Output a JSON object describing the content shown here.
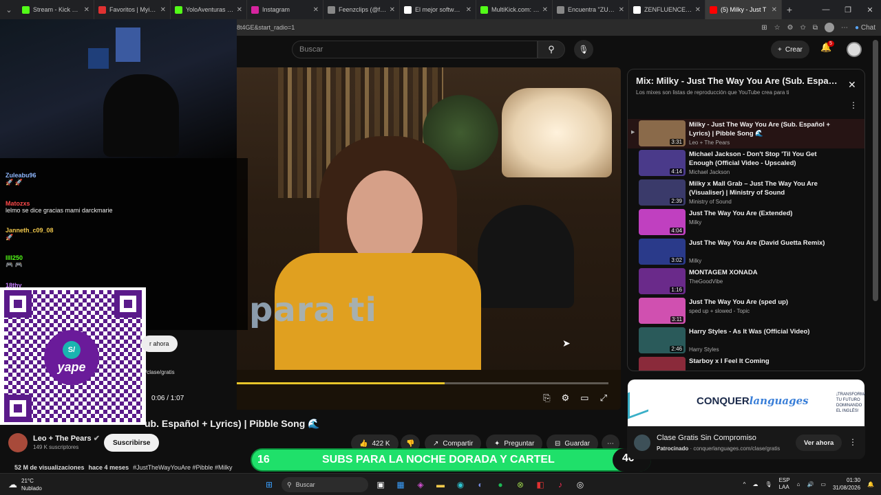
{
  "tabs": [
    {
      "title": "Stream - Kick Dashbo",
      "color": "#53fc18"
    },
    {
      "title": "Favoritos | Myinstant",
      "color": "#e03131"
    },
    {
      "title": "YoloAventuras Strea",
      "color": "#53fc18"
    },
    {
      "title": "Instagram",
      "color": "#d6249f"
    },
    {
      "title": "Feenzclips (@feenz",
      "color": "#888888"
    },
    {
      "title": "El mejor software pa",
      "color": "#ffffff"
    },
    {
      "title": "MultiKick.com: Watc",
      "color": "#53fc18"
    },
    {
      "title": "Encuentra \"ZULLY\" e",
      "color": "#888888"
    },
    {
      "title": "ZENFLUENCER (@ze",
      "color": "#ffffff"
    },
    {
      "title": "(5) Milky - Just T",
      "color": "#ff0000"
    }
  ],
  "browser": {
    "url_fragment": "8t4GE&start_radio=1",
    "chat_label": "Chat"
  },
  "header": {
    "search_placeholder": "Buscar",
    "create_label": "Crear",
    "notif_count": "5"
  },
  "video": {
    "overlay_text": "para ti",
    "time": "0:06 / 1:07",
    "progress": 0.56,
    "ver_ahora": "r ahora",
    "clase_link": "/clase/gratis"
  },
  "chat": [
    {
      "name": "Zuleabu96",
      "color": "#8fb8ff",
      "msg": "🚀 🚀"
    },
    {
      "name": "Matozxs",
      "color": "#ff4a4a",
      "msg": "lelmo se dice gracias mami darckmarie"
    },
    {
      "name": "Janneth_c09_08",
      "color": "#f2c94c",
      "msg": "🚀"
    },
    {
      "name": "llll250",
      "color": "#53fc18",
      "msg": "🎮 🎮"
    },
    {
      "name": "18thy",
      "color": "#c77dff",
      "msg": ""
    }
  ],
  "below": {
    "title": "ub. Español + Lyrics) | Pibble Song 🌊",
    "channel": "Leo + The Pears",
    "subs": "149 K suscriptores",
    "subscribe": "Suscribirse",
    "likes": "422 K",
    "share": "Compartir",
    "ask": "Preguntar",
    "save": "Guardar",
    "views": "52 M de visualizaciones",
    "ago": "hace 4 meses",
    "tags": "#JustTheWayYouAre #Pibble #Milky"
  },
  "banner": {
    "left": "16",
    "text": "SUBS PARA LA NOCHE DORADA Y CARTEL",
    "right": "40"
  },
  "playlist": {
    "title": "Mix: Milky - Just The Way You Are (Sub. Español + Lyrics)",
    "subtitle": "Los mixes son listas de reproducción que YouTube crea para ti",
    "items": [
      {
        "title": "Milky - Just The Way You Are (Sub. Español + Lyrics) | Pibble Song 🌊",
        "channel": "Leo + The Pears",
        "dur": "3:31",
        "color": "#8a6a4a"
      },
      {
        "title": "Michael Jackson - Don't Stop 'Til You Get Enough (Official Video - Upscaled)",
        "channel": "Michael Jackson",
        "dur": "4:14",
        "color": "#4a3a8a"
      },
      {
        "title": "Milky x Mall Grab – Just The Way You Are (Visualiser) | Ministry of Sound",
        "channel": "Ministry of Sound",
        "dur": "2:39",
        "color": "#3a3a6a"
      },
      {
        "title": "Just The Way You Are (Extended)",
        "channel": "Milky",
        "dur": "4:04",
        "color": "#c040c0"
      },
      {
        "title": "Just The Way You Are (David Guetta Remix)",
        "channel": "Milky",
        "dur": "3:02",
        "color": "#2a3a8a"
      },
      {
        "title": "MONTAGEM XONADA",
        "channel": "TheGoodVibe",
        "dur": "1:16",
        "color": "#6a2a8a"
      },
      {
        "title": "Just The Way You Are (sped up)",
        "channel": "sped up + slowed - Topic",
        "dur": "3:11",
        "color": "#d050b0"
      },
      {
        "title": "Harry Styles - As It Was (Official Video)",
        "channel": "Harry Styles",
        "dur": "2:46",
        "color": "#2a5a5a"
      },
      {
        "title": "Starboy x I Feel It Coming",
        "channel": "",
        "dur": "",
        "color": "#8a2a3a"
      }
    ]
  },
  "ad": {
    "brand_a": "CONQUER",
    "brand_b": "languages",
    "side_text": "¡TRANSFORMA TU FUTURO DOMINANDO EL INGLÉS!",
    "title": "Clase Gratis Sin Compromiso",
    "sponsored": "Patrocinado",
    "domain": "conquerlanguages.com/clase/gratis",
    "cta": "Ver ahora"
  },
  "qr": {
    "brand": "yape",
    "symbol": "S/"
  },
  "taskbar": {
    "temp": "21°C",
    "weather": "Nublado",
    "search": "Buscar",
    "lang1": "ESP",
    "lang2": "LAA",
    "time": "01:30",
    "date": "31/08/2026"
  }
}
